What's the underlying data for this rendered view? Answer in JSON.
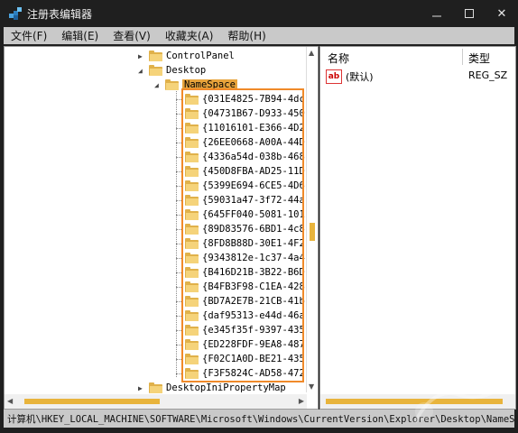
{
  "window": {
    "title": "注册表编辑器",
    "close": "✕"
  },
  "menu": [
    "文件(F)",
    "编辑(E)",
    "查看(V)",
    "收藏夹(A)",
    "帮助(H)"
  ],
  "tree": {
    "parents": [
      {
        "label": "ControlPanel",
        "expander": "▶"
      },
      {
        "label": "Desktop",
        "expander": "◢"
      }
    ],
    "selected": {
      "label": "NameSpace",
      "expander": "◢"
    },
    "children": [
      "{031E4825-7B94-4dc",
      "{04731B67-D933-450",
      "{11016101-E366-4D2",
      "{26EE0668-A00A-44D",
      "{4336a54d-038b-468",
      "{450D8FBA-AD25-11D",
      "{5399E694-6CE5-4D6",
      "{59031a47-3f72-44a",
      "{645FF040-5081-101",
      "{89D83576-6BD1-4c8",
      "{8FD8B88D-30E1-4F2",
      "{9343812e-1c37-4a4",
      "{B416D21B-3B22-B6D",
      "{B4FB3F98-C1EA-428",
      "{BD7A2E7B-21CB-41b",
      "{daf95313-e44d-46a",
      "{e345f35f-9397-435",
      "{ED228FDF-9EA8-487",
      "{F02C1A0D-BE21-435",
      "{F3F5824C-AD58-472"
    ],
    "after": {
      "label": "DesktopIniPropertyMap",
      "expander": "▶"
    }
  },
  "list": {
    "columns": [
      "名称",
      "类型"
    ],
    "rows": [
      {
        "name": "(默认)",
        "type": "REG_SZ"
      }
    ]
  },
  "status": {
    "path": "计算机\\HKEY_LOCAL_MACHINE\\SOFTWARE\\Microsoft\\Windows\\CurrentVersion\\Explorer\\Desktop\\NameS"
  },
  "colors": {
    "highlight": "#f08a2a",
    "selected": "#e8a43c",
    "folder": "#f5d37a"
  }
}
